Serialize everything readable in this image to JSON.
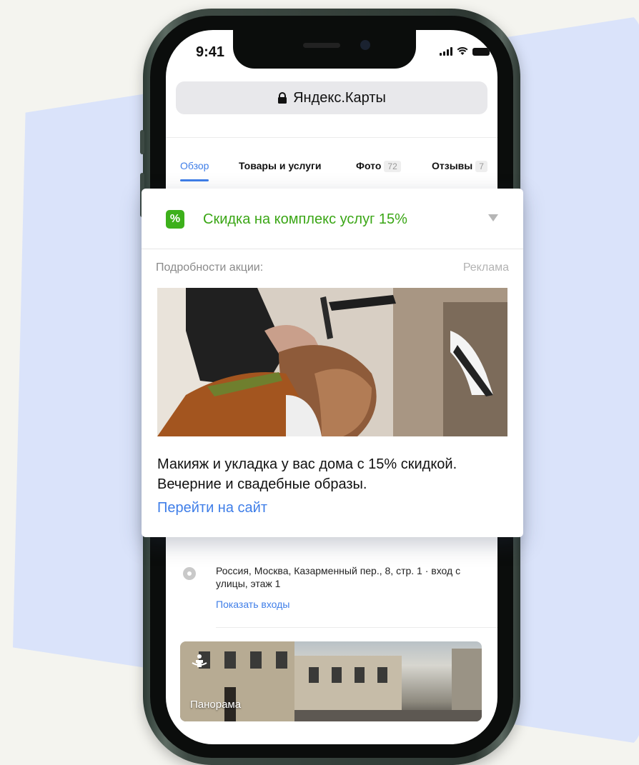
{
  "status_bar": {
    "time": "9:41"
  },
  "browser": {
    "url_label": "Яндекс.Карты"
  },
  "tabs": [
    {
      "label": "Обзор"
    },
    {
      "label": "Товары и услуги"
    },
    {
      "label": "Фото",
      "count": "72"
    },
    {
      "label": "Отзывы",
      "count": "7"
    }
  ],
  "promo": {
    "icon_symbol": "%",
    "title": "Скидка на комплекс услуг 15%",
    "details_label": "Подробности акции:",
    "ad_label": "Реклама",
    "description": "Макияж и укладка у вас дома с 15% скидкой. Вечерние и свадебные образы.",
    "link_label": "Перейти на сайт",
    "colors": {
      "accent_green": "#3aa615",
      "link_blue": "#3f7ee8"
    }
  },
  "address": {
    "text": "Россия, Москва, Казарменный пер., 8, стр. 1 · вход с улицы, этаж 1",
    "show_entries_label": "Показать входы"
  },
  "panorama": {
    "label": "Панорама",
    "icon": "panorama-icon"
  }
}
